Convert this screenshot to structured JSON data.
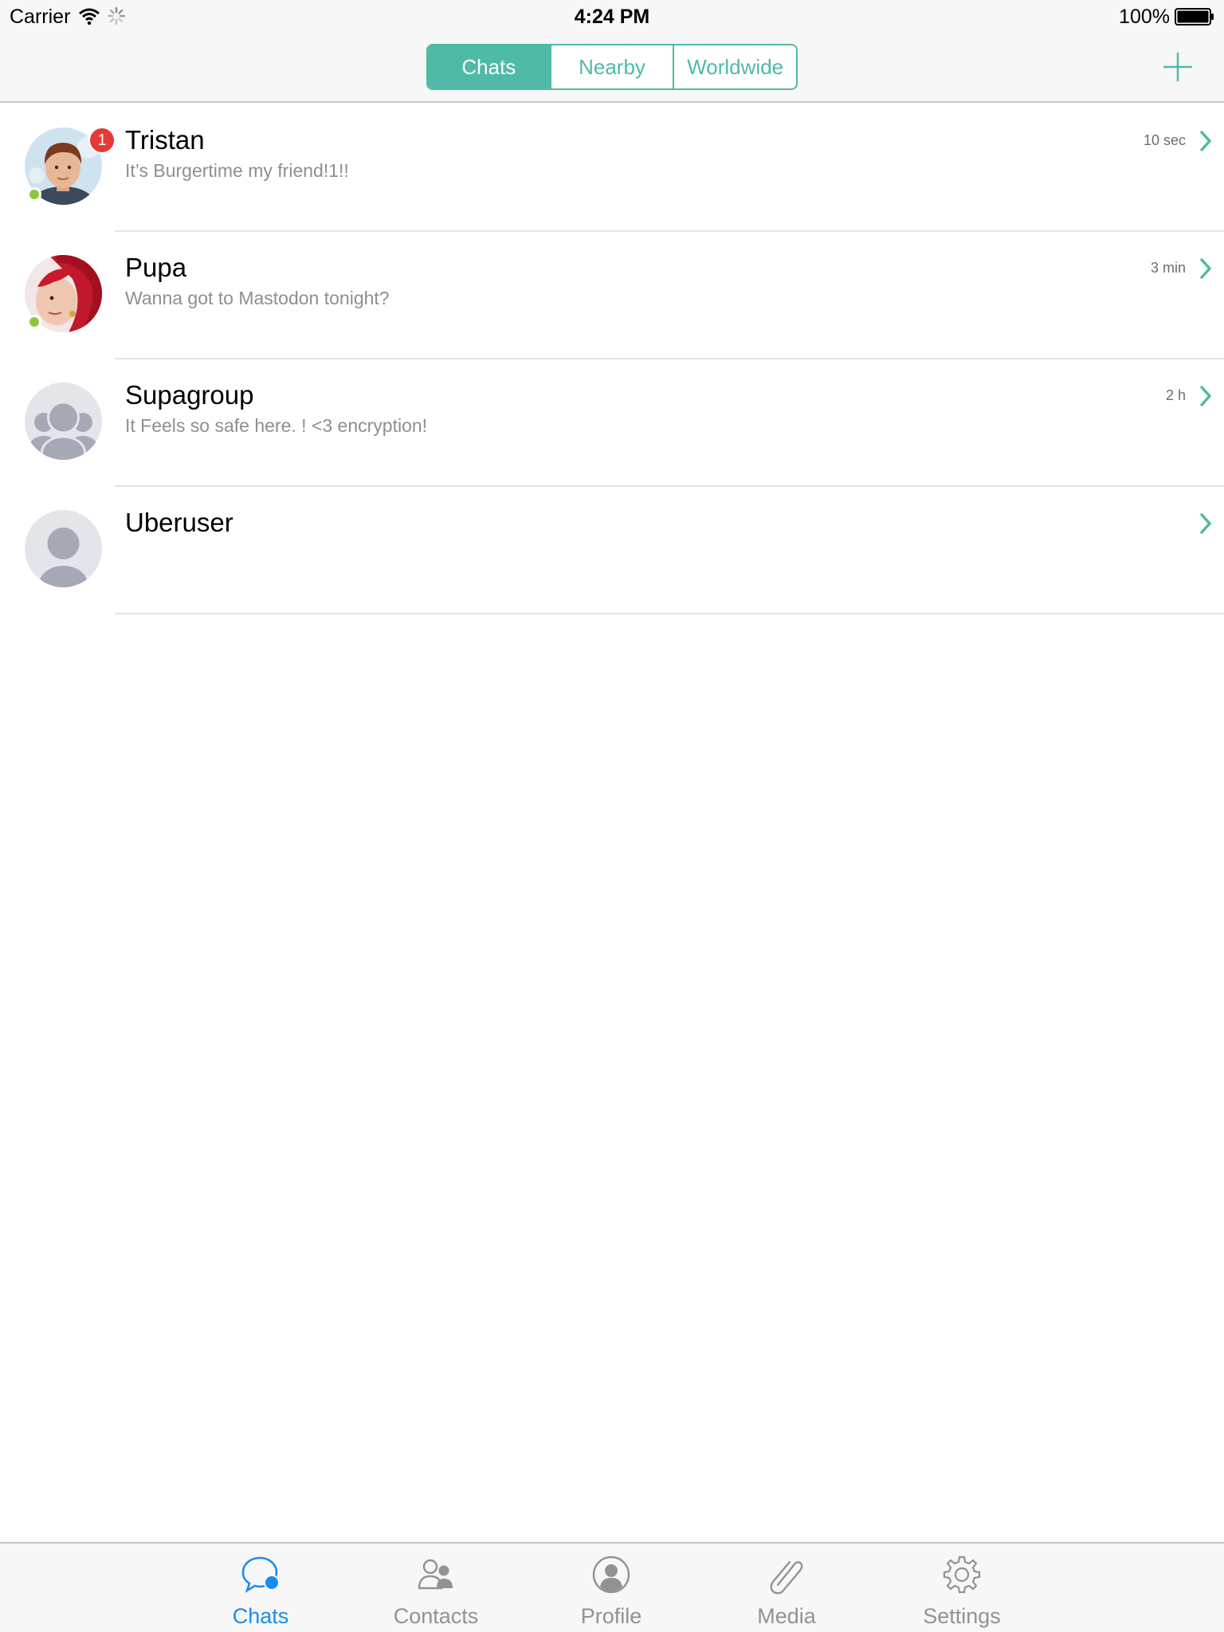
{
  "status_bar": {
    "carrier": "Carrier",
    "time": "4:24 PM",
    "battery": "100%"
  },
  "segments": [
    {
      "label": "Chats",
      "active": true
    },
    {
      "label": "Nearby",
      "active": false
    },
    {
      "label": "Worldwide",
      "active": false
    }
  ],
  "accent_color": "#4fbaa6",
  "chats": [
    {
      "name": "Tristan",
      "preview": "It’s Burgertime my friend!1!!",
      "time": "10 sec",
      "badge": "1",
      "online": true,
      "avatar": "photo-boy"
    },
    {
      "name": "Pupa",
      "preview": "Wanna got to Mastodon tonight?",
      "time": "3 min",
      "online": true,
      "avatar": "photo-redhair"
    },
    {
      "name": "Supagroup",
      "preview": "It Feels so safe here. ! <3 encryption!",
      "time": "2 h",
      "online": false,
      "avatar": "group-placeholder"
    },
    {
      "name": "Uberuser",
      "preview": "",
      "time": "",
      "online": false,
      "avatar": "user-placeholder"
    }
  ],
  "tabs": [
    {
      "label": "Chats",
      "icon": "chat-bubble-icon",
      "active": true
    },
    {
      "label": "Contacts",
      "icon": "contacts-icon",
      "active": false
    },
    {
      "label": "Profile",
      "icon": "profile-icon",
      "active": false
    },
    {
      "label": "Media",
      "icon": "paperclip-icon",
      "active": false
    },
    {
      "label": "Settings",
      "icon": "gear-icon",
      "active": false
    }
  ],
  "tab_active_color": "#1a8cf0"
}
